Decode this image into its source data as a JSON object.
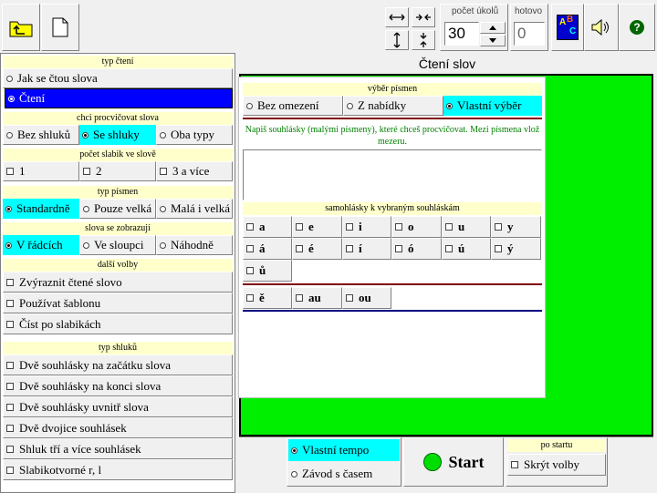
{
  "colors": {
    "accent_cyan": "#00ffff",
    "selected_blue": "#0000ff",
    "header_yellow": "#ffffcc",
    "green_area": "#00ee00",
    "divider_red": "#cc0000",
    "divider_blue": "#000080"
  },
  "toolbar": {
    "open_icon": "folder-up-icon",
    "new_icon": "new-document-icon",
    "pocet_ukolu_label": "počet úkolů",
    "pocet_ukolu_value": "30",
    "hotovo_label": "hotovo",
    "hotovo_value": "0",
    "abc_icon_text": "ABC",
    "help_text": "?"
  },
  "main_title": "Čtení slov",
  "left": {
    "typ_cteni": {
      "header": "typ čtení",
      "options": [
        "Jak se čtou slova",
        "Čtení"
      ]
    },
    "procvicovat": {
      "header": "chci procvičovat slova",
      "options": [
        "Bez shluků",
        "Se shluky",
        "Oba typy"
      ]
    },
    "slabiky": {
      "header": "počet slabik ve slově",
      "options": [
        "1",
        "2",
        "3 a více"
      ]
    },
    "typ_pismen": {
      "header": "typ písmen",
      "options": [
        "Standardně",
        "Pouze velká",
        "Malá i velká"
      ]
    },
    "zobrazuji": {
      "header": "slova se zobrazují",
      "options": [
        "V řádcích",
        "Ve sloupci",
        "Náhodně"
      ]
    },
    "dalsi": {
      "header": "další volby",
      "options": [
        "Zvýraznit čtené slovo",
        "Používat šablonu",
        "Číst po slabikách"
      ]
    },
    "shluky": {
      "header": "typ shluků",
      "options": [
        "Dvě souhlásky na začátku slova",
        "Dvě souhlásky na konci slova",
        "Dvě souhlásky uvnitř slova",
        "Dvě dvojice souhlásek",
        "Shluk tří a více souhlásek",
        "Slabikotvorné r, l"
      ]
    }
  },
  "panel": {
    "vyber_header": "výběr písmen",
    "vyber_options": [
      "Bez omezení",
      "Z nabídky",
      "Vlastní výběr"
    ],
    "instruction": "Napiš souhlásky (malými písmeny), které chceš procvičovat. Mezi písmena vlož mezeru.",
    "textarea_value": "",
    "samohlasky_header": "samohlásky k vybraným souhláskám",
    "vowels_row1": [
      "a",
      "e",
      "i",
      "o",
      "u",
      "y"
    ],
    "vowels_row2": [
      "á",
      "é",
      "í",
      "ó",
      "ú",
      "ý"
    ],
    "vowels_row3": [
      "ů"
    ],
    "diphthongs": [
      "ě",
      "au",
      "ou"
    ]
  },
  "bottom": {
    "tempo_options": [
      "Vlastní tempo",
      "Závod s časem"
    ],
    "start_label": "Start",
    "po_startu_header": "po startu",
    "skryt_volby": "Skrýt volby"
  }
}
